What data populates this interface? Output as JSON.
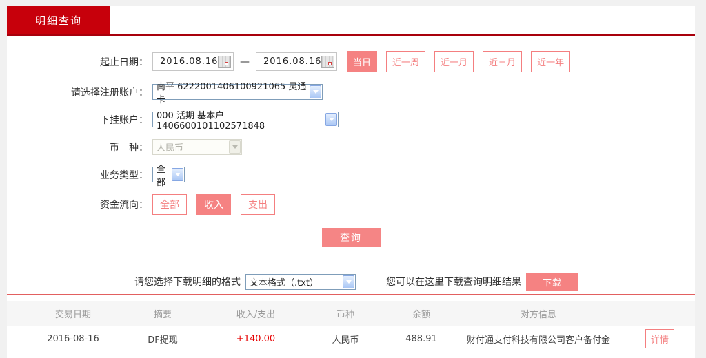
{
  "tab": {
    "label": "明细查询"
  },
  "form": {
    "date_row": {
      "label": "起止日期：",
      "start_date": "2016.08.16",
      "end_date": "2016.08.16",
      "separator": "—",
      "quick_buttons": [
        {
          "label": "当日",
          "active": true
        },
        {
          "label": "近一周",
          "active": false
        },
        {
          "label": "近一月",
          "active": false
        },
        {
          "label": "近三月",
          "active": false
        },
        {
          "label": "近一年",
          "active": false
        }
      ]
    },
    "account_row": {
      "label": "请选择注册账户：",
      "value": "南平 6222001406100921065 灵通卡"
    },
    "sub_account_row": {
      "label": "下挂账户：",
      "value": "000 活期 基本户 1406600101102571848"
    },
    "currency_row": {
      "label": "币　种：",
      "value": "人民币",
      "disabled": true
    },
    "business_type_row": {
      "label": "业务类型：",
      "value": "全部"
    },
    "fund_flow_row": {
      "label": "资金流向：",
      "options": [
        {
          "label": "全部",
          "active": false
        },
        {
          "label": "收入",
          "active": true
        },
        {
          "label": "支出",
          "active": false
        }
      ]
    },
    "query_button": "查询"
  },
  "download": {
    "label": "请您选择下载明细的格式",
    "format_value": "文本格式（.txt）",
    "hint": "您可以在这里下载查询明细结果",
    "button": "下载"
  },
  "table": {
    "headers": [
      "交易日期",
      "摘要",
      "收入/支出",
      "币种",
      "余额",
      "对方信息"
    ],
    "rows": [
      {
        "date": "2016-08-16",
        "summary": "DF提现",
        "amount": "+140.00",
        "currency": "人民币",
        "balance": "488.91",
        "counterparty": "财付通支付科技有限公司客户备付金",
        "action": "详情"
      }
    ]
  },
  "colors": {
    "brand_red": "#c7000b",
    "accent_salmon": "#f58282",
    "amount_red": "#e60000",
    "table_separator": "#e26060"
  }
}
